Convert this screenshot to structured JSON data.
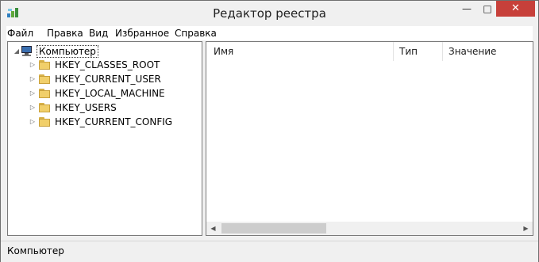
{
  "window": {
    "title": "Редактор реестра",
    "controls": {
      "minimize": "—",
      "maximize": "□",
      "close": "✕"
    }
  },
  "menu": [
    "Файл",
    "Правка",
    "Вид",
    "Избранное",
    "Справка"
  ],
  "tree": {
    "root": "Компьютер",
    "items": [
      "HKEY_CLASSES_ROOT",
      "HKEY_CURRENT_USER",
      "HKEY_LOCAL_MACHINE",
      "HKEY_USERS",
      "HKEY_CURRENT_CONFIG"
    ]
  },
  "list": {
    "columns": [
      "Имя",
      "Тип",
      "Значение"
    ]
  },
  "status": {
    "text": "Компьютер"
  },
  "colors": {
    "close_button": "#c7403a",
    "folder": "#f1cf6a"
  }
}
